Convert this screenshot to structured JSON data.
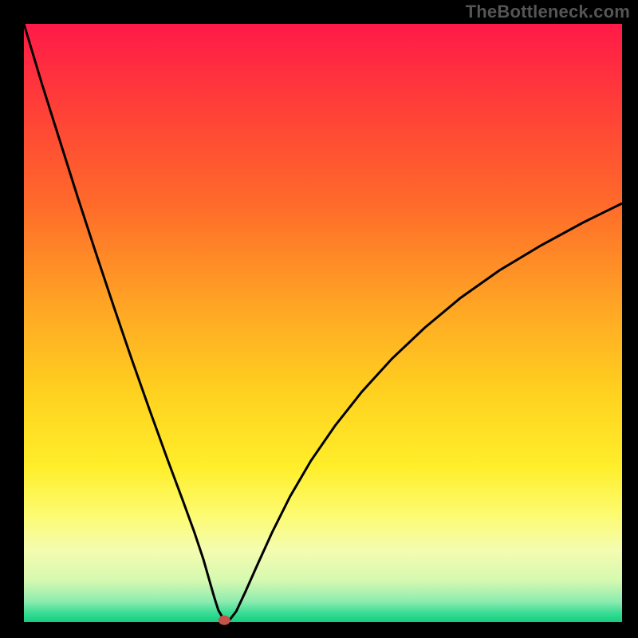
{
  "watermark": "TheBottleneck.com",
  "chart_data": {
    "type": "line",
    "title": "",
    "xlabel": "",
    "ylabel": "",
    "xlim": [
      0,
      100
    ],
    "ylim": [
      0,
      100
    ],
    "background_gradient": {
      "stops": [
        {
          "offset": 0.0,
          "color": "#ff1a48"
        },
        {
          "offset": 0.12,
          "color": "#ff3a3a"
        },
        {
          "offset": 0.3,
          "color": "#ff6a2a"
        },
        {
          "offset": 0.48,
          "color": "#ffa824"
        },
        {
          "offset": 0.62,
          "color": "#ffd21f"
        },
        {
          "offset": 0.74,
          "color": "#ffee2a"
        },
        {
          "offset": 0.82,
          "color": "#fdfb70"
        },
        {
          "offset": 0.88,
          "color": "#f4fcb0"
        },
        {
          "offset": 0.93,
          "color": "#d6f9b0"
        },
        {
          "offset": 0.965,
          "color": "#8fecb0"
        },
        {
          "offset": 0.985,
          "color": "#39dc94"
        },
        {
          "offset": 1.0,
          "color": "#12cf7e"
        }
      ]
    },
    "series": [
      {
        "name": "bottleneck-curve",
        "color": "#000000",
        "x": [
          0.0,
          3.0,
          6.0,
          9.0,
          12.0,
          15.0,
          18.0,
          21.0,
          24.0,
          26.5,
          28.5,
          30.0,
          31.0,
          31.8,
          32.5,
          33.2,
          34.0,
          34.5,
          35.5,
          37.0,
          39.0,
          41.5,
          44.5,
          48.0,
          52.0,
          56.5,
          61.5,
          67.0,
          73.0,
          79.5,
          86.5,
          93.5,
          100.0
        ],
        "y": [
          100.0,
          90.0,
          80.5,
          71.0,
          61.8,
          52.8,
          44.0,
          35.5,
          27.2,
          20.5,
          15.0,
          10.5,
          7.0,
          4.2,
          2.0,
          0.8,
          0.3,
          0.5,
          1.8,
          5.0,
          9.5,
          15.0,
          21.0,
          27.0,
          32.8,
          38.5,
          44.0,
          49.2,
          54.2,
          58.8,
          63.0,
          66.8,
          70.0
        ]
      }
    ],
    "marker": {
      "x": 33.5,
      "y": 0.3,
      "color": "#c4534b"
    }
  }
}
